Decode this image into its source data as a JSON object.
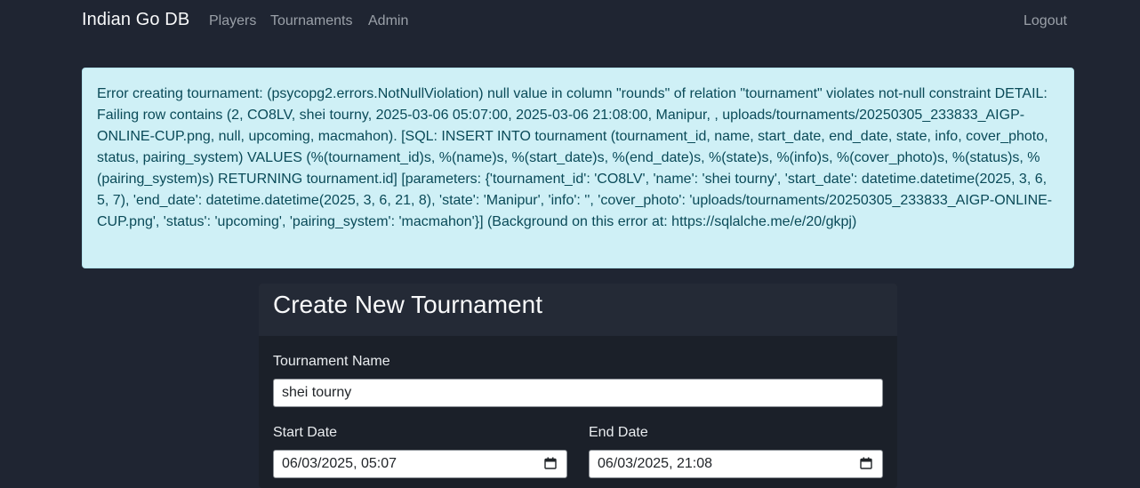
{
  "nav": {
    "brand": "Indian Go DB",
    "links": [
      "Players",
      "Tournaments",
      "Admin"
    ],
    "logout": "Logout"
  },
  "alert": {
    "message": "Error creating tournament: (psycopg2.errors.NotNullViolation) null value in column \"rounds\" of relation \"tournament\" violates not-null constraint DETAIL: Failing row contains (2, CO8LV, shei tourny, 2025-03-06 05:07:00, 2025-03-06 21:08:00, Manipur, , uploads/tournaments/20250305_233833_AIGP-ONLINE-CUP.png, null, upcoming, macmahon). [SQL: INSERT INTO tournament (tournament_id, name, start_date, end_date, state, info, cover_photo, status, pairing_system) VALUES (%(tournament_id)s, %(name)s, %(start_date)s, %(end_date)s, %(state)s, %(info)s, %(cover_photo)s, %(status)s, %(pairing_system)s) RETURNING tournament.id] [parameters: {'tournament_id': 'CO8LV', 'name': 'shei tourny', 'start_date': datetime.datetime(2025, 3, 6, 5, 7), 'end_date': datetime.datetime(2025, 3, 6, 21, 8), 'state': 'Manipur', 'info': '', 'cover_photo': 'uploads/tournaments/20250305_233833_AIGP-ONLINE-CUP.png', 'status': 'upcoming', 'pairing_system': 'macmahon'}] (Background on this error at: https://sqlalche.me/e/20/gkpj)"
  },
  "form": {
    "title": "Create New Tournament",
    "name_label": "Tournament Name",
    "name_value": "shei tourny",
    "start_label": "Start Date",
    "start_value": "06/03/2025, 05:07",
    "end_label": "End Date",
    "end_value": "06/03/2025, 21:08"
  },
  "icons": {
    "calendar": "calendar-icon"
  }
}
